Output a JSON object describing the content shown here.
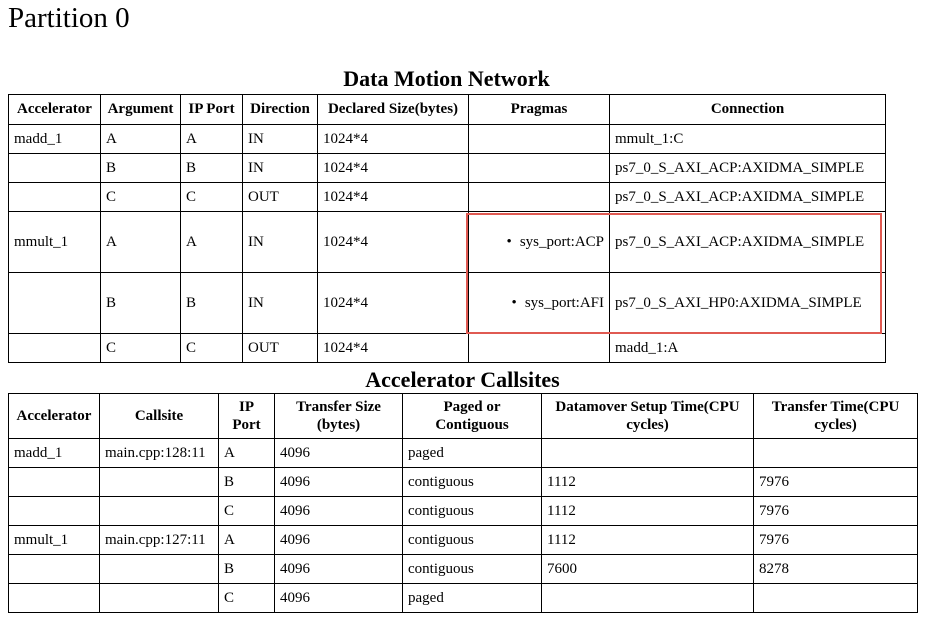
{
  "page": {
    "title": "Partition 0"
  },
  "dmn": {
    "title": "Data Motion Network",
    "headers": [
      "Accelerator",
      "Argument",
      "IP Port",
      "Direction",
      "Declared Size(bytes)",
      "Pragmas",
      "Connection"
    ],
    "rows": [
      {
        "accel": "madd_1",
        "arg": "A",
        "port": "A",
        "dir": "IN",
        "size": "1024*4",
        "pragma": "",
        "conn": "mmult_1:C"
      },
      {
        "accel": "",
        "arg": "B",
        "port": "B",
        "dir": "IN",
        "size": "1024*4",
        "pragma": "",
        "conn": "ps7_0_S_AXI_ACP:AXIDMA_SIMPLE"
      },
      {
        "accel": "",
        "arg": "C",
        "port": "C",
        "dir": "OUT",
        "size": "1024*4",
        "pragma": "",
        "conn": "ps7_0_S_AXI_ACP:AXIDMA_SIMPLE"
      },
      {
        "accel": "mmult_1",
        "arg": "A",
        "port": "A",
        "dir": "IN",
        "size": "1024*4",
        "pragma": "sys_port:ACP",
        "conn": "ps7_0_S_AXI_ACP:AXIDMA_SIMPLE"
      },
      {
        "accel": "",
        "arg": "B",
        "port": "B",
        "dir": "IN",
        "size": "1024*4",
        "pragma": "sys_port:AFI",
        "conn": "ps7_0_S_AXI_HP0:AXIDMA_SIMPLE"
      },
      {
        "accel": "",
        "arg": "C",
        "port": "C",
        "dir": "OUT",
        "size": "1024*4",
        "pragma": "",
        "conn": "madd_1:A"
      }
    ]
  },
  "callsites": {
    "title": "Accelerator Callsites",
    "headers": [
      "Accelerator",
      "Callsite",
      "IP Port",
      "Transfer Size (bytes)",
      "Paged or Contiguous",
      "Datamover Setup Time(CPU cycles)",
      "Transfer Time(CPU cycles)"
    ],
    "rows": [
      {
        "accel": "madd_1",
        "callsite": "main.cpp:128:11",
        "port": "A",
        "size": "4096",
        "paged": "paged",
        "setup": "",
        "transfer": ""
      },
      {
        "accel": "",
        "callsite": "",
        "port": "B",
        "size": "4096",
        "paged": "contiguous",
        "setup": "1112",
        "transfer": "7976"
      },
      {
        "accel": "",
        "callsite": "",
        "port": "C",
        "size": "4096",
        "paged": "contiguous",
        "setup": "1112",
        "transfer": "7976"
      },
      {
        "accel": "mmult_1",
        "callsite": "main.cpp:127:11",
        "port": "A",
        "size": "4096",
        "paged": "contiguous",
        "setup": "1112",
        "transfer": "7976"
      },
      {
        "accel": "",
        "callsite": "",
        "port": "B",
        "size": "4096",
        "paged": "contiguous",
        "setup": "7600",
        "transfer": "8278"
      },
      {
        "accel": "",
        "callsite": "",
        "port": "C",
        "size": "4096",
        "paged": "paged",
        "setup": "",
        "transfer": ""
      }
    ]
  },
  "colors": {
    "highlight": "#e05a52"
  }
}
